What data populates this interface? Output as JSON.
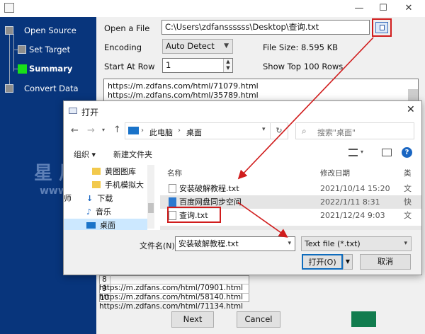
{
  "window": {
    "title_icon": "app-icon",
    "minimize": "—",
    "maximize": "☐",
    "close": "✕"
  },
  "sidebar": {
    "steps": [
      {
        "label": "Open Source",
        "state": "done"
      },
      {
        "label": "Set Target",
        "state": "done"
      },
      {
        "label": "Summary",
        "state": "current"
      },
      {
        "label": "Convert Data",
        "state": "todo"
      }
    ]
  },
  "form": {
    "open_file_label": "Open a File",
    "file_path": "C:\\Users\\zdfanssssss\\Desktop\\查询.txt",
    "encoding_label": "Encoding",
    "encoding_value": "Auto Detect",
    "file_size_label": "File Size: 8.595 KB",
    "start_row_label": "Start At Row",
    "start_row_value": "1",
    "show_top_label": "Show Top 100 Rows"
  },
  "preview": {
    "lines": [
      "https://m.zdfans.com/html/71079.html",
      "https://m.zdfans.com/html/35789.html"
    ],
    "table_rows": [
      {
        "n": "8",
        "url": "https://m.zdfans.com/html/70901.html"
      },
      {
        "n": "9",
        "url": "https://m.zdfans.com/html/58140.html"
      },
      {
        "n": "10",
        "url": "https://m.zdfans.com/html/71134.html"
      }
    ]
  },
  "footer": {
    "next_label": "Next",
    "cancel_label": "Cancel"
  },
  "dialog": {
    "title": "打开",
    "close": "✕",
    "breadcrumb": {
      "root": "此电脑",
      "sep": "›",
      "current": "桌面"
    },
    "search_placeholder": "搜索\"桌面\"",
    "organize_label": "组织 ▾",
    "new_folder_label": "新建文件夹",
    "help": "?",
    "tree": [
      {
        "label": "黄图图库"
      },
      {
        "label": "手机模拟大师"
      },
      {
        "label": "下载"
      },
      {
        "label": "音乐"
      },
      {
        "label": "桌面"
      }
    ],
    "columns": {
      "name": "名称",
      "modified": "修改日期",
      "type": "类"
    },
    "files": [
      {
        "name": "安装破解教程.txt",
        "date": "2021/10/14 15:20",
        "type": "文"
      },
      {
        "name": "百度网盘同步空间",
        "date": "2022/1/11 8:31",
        "type": "快"
      },
      {
        "name": "查询.txt",
        "date": "2021/12/24 9:03",
        "type": "文"
      }
    ],
    "filename_label": "文件名(N):",
    "filename_value": "安装破解教程.txt",
    "filetype_value": "Text file (*.txt)",
    "open_label": "打开(O)",
    "cancel_label": "取消"
  },
  "watermark": {
    "line1": "星 风",
    "line2": "www"
  },
  "colors": {
    "sidebar": "#08357c",
    "highlight_step": "#19e019",
    "annotation_red": "#d01c1c",
    "footer_accent": "#117c4e"
  }
}
